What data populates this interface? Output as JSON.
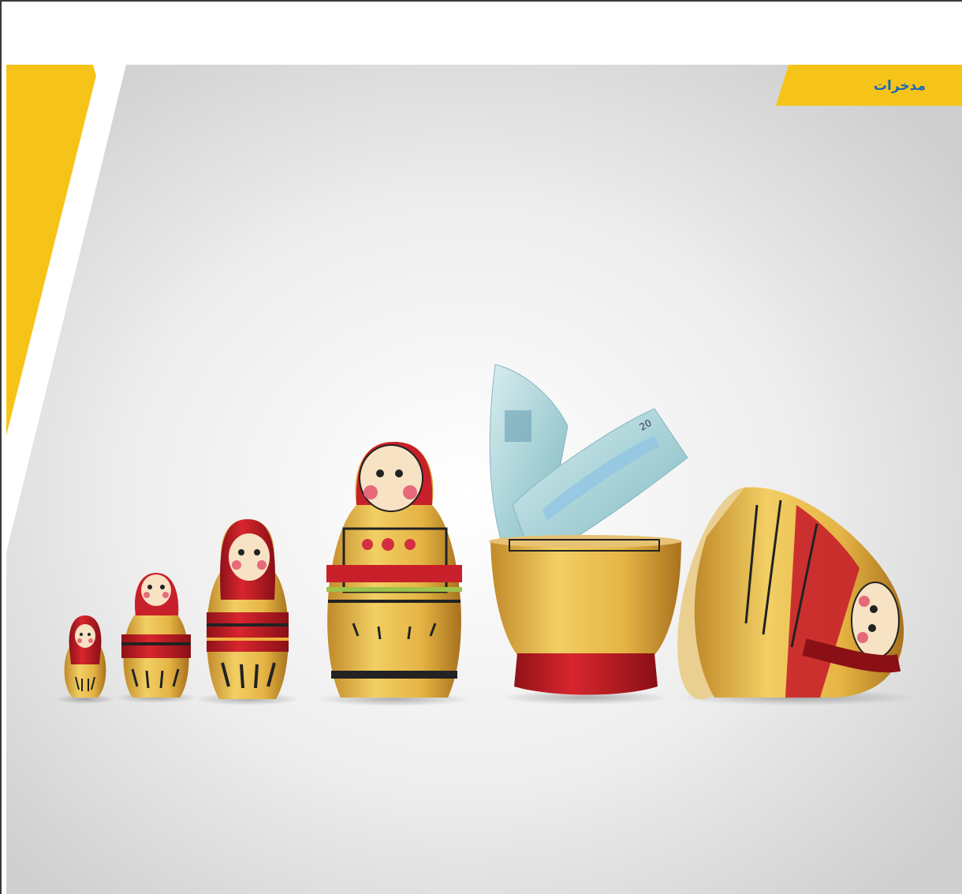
{
  "section_tag": {
    "label": "مدخرات"
  },
  "banknote": {
    "denomination": "20"
  },
  "colors": {
    "accent_yellow": "#f6c419",
    "tag_text_blue": "#1b67b8",
    "doll_red": "#c8202a",
    "doll_wood": "#e2b43c"
  }
}
